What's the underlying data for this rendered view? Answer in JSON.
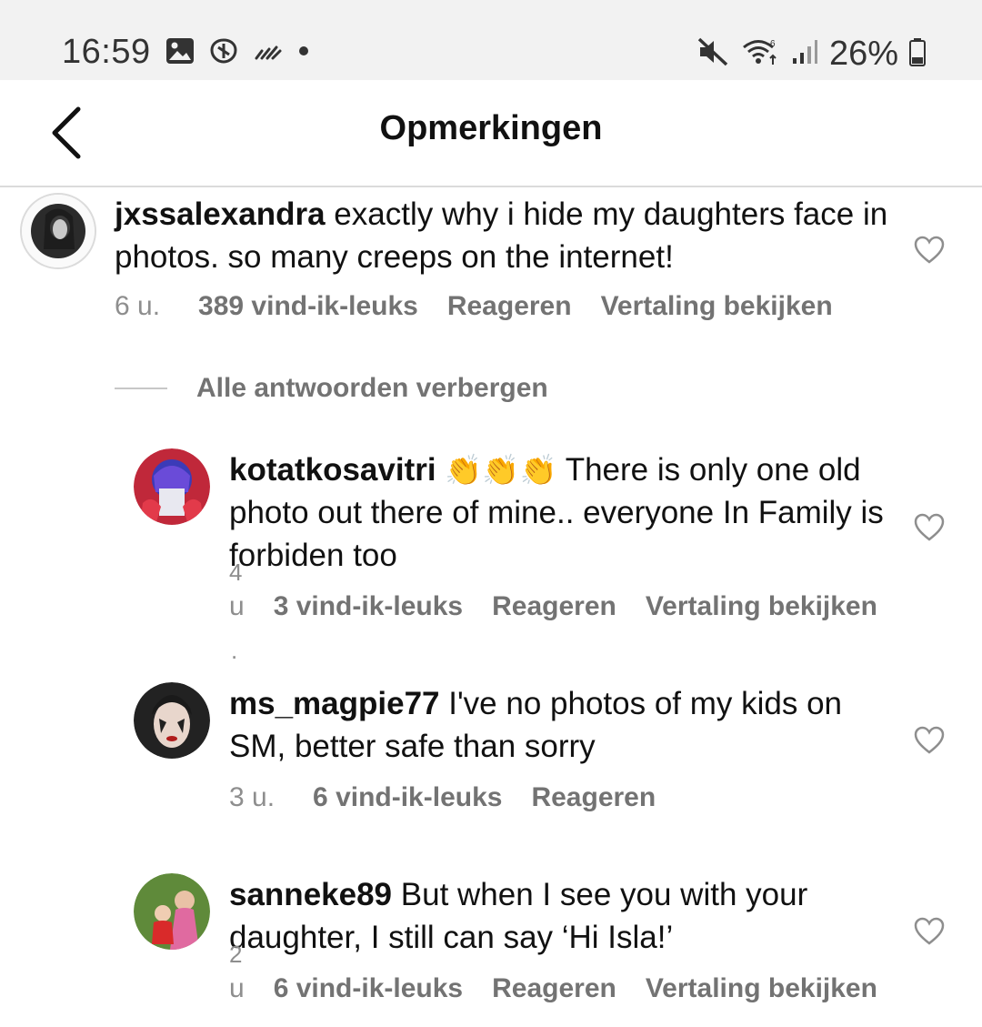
{
  "status_bar": {
    "time": "16:59",
    "battery": "26%",
    "left_icons": [
      "gallery-icon",
      "shield-icon",
      "wifi-calling-icon",
      "dot-icon"
    ],
    "right_icons": [
      "mute-icon",
      "wifi-icon",
      "signal-icon",
      "battery-icon"
    ]
  },
  "header": {
    "title": "Opmerkingen",
    "back_icon": "chevron-left-icon"
  },
  "comments": [
    {
      "username": "jxssalexandra",
      "text": "exactly why i hide my daughters face in photos. so many creeps on the internet!",
      "time": "6 u.",
      "likes": "389 vind-ik-leuks",
      "reply": "Reageren",
      "translate": "Vertaling bekijken"
    }
  ],
  "hide_replies": "Alle antwoorden verbergen",
  "replies": [
    {
      "username": "kotatkosavitri",
      "emoji": "👏👏👏",
      "text": "There is only one old photo out there of mine.. everyone In Family is forbiden too",
      "time_stacked": [
        "4",
        "u",
        "."
      ],
      "likes": "3 vind-ik-leuks",
      "reply": "Reageren",
      "translate": "Vertaling bekijken"
    },
    {
      "username": "ms_magpie77",
      "text": "I've no photos of my kids on SM, better safe than sorry",
      "time": "3 u.",
      "likes": "6 vind-ik-leuks",
      "reply": "Reageren"
    },
    {
      "username": "sanneke89",
      "text": "But when I see you with your daughter, I still can say ‘Hi Isla!’",
      "time_stacked": [
        "2",
        "u"
      ],
      "likes": "6 vind-ik-leuks",
      "reply": "Reageren",
      "translate": "Vertaling bekijken"
    }
  ]
}
